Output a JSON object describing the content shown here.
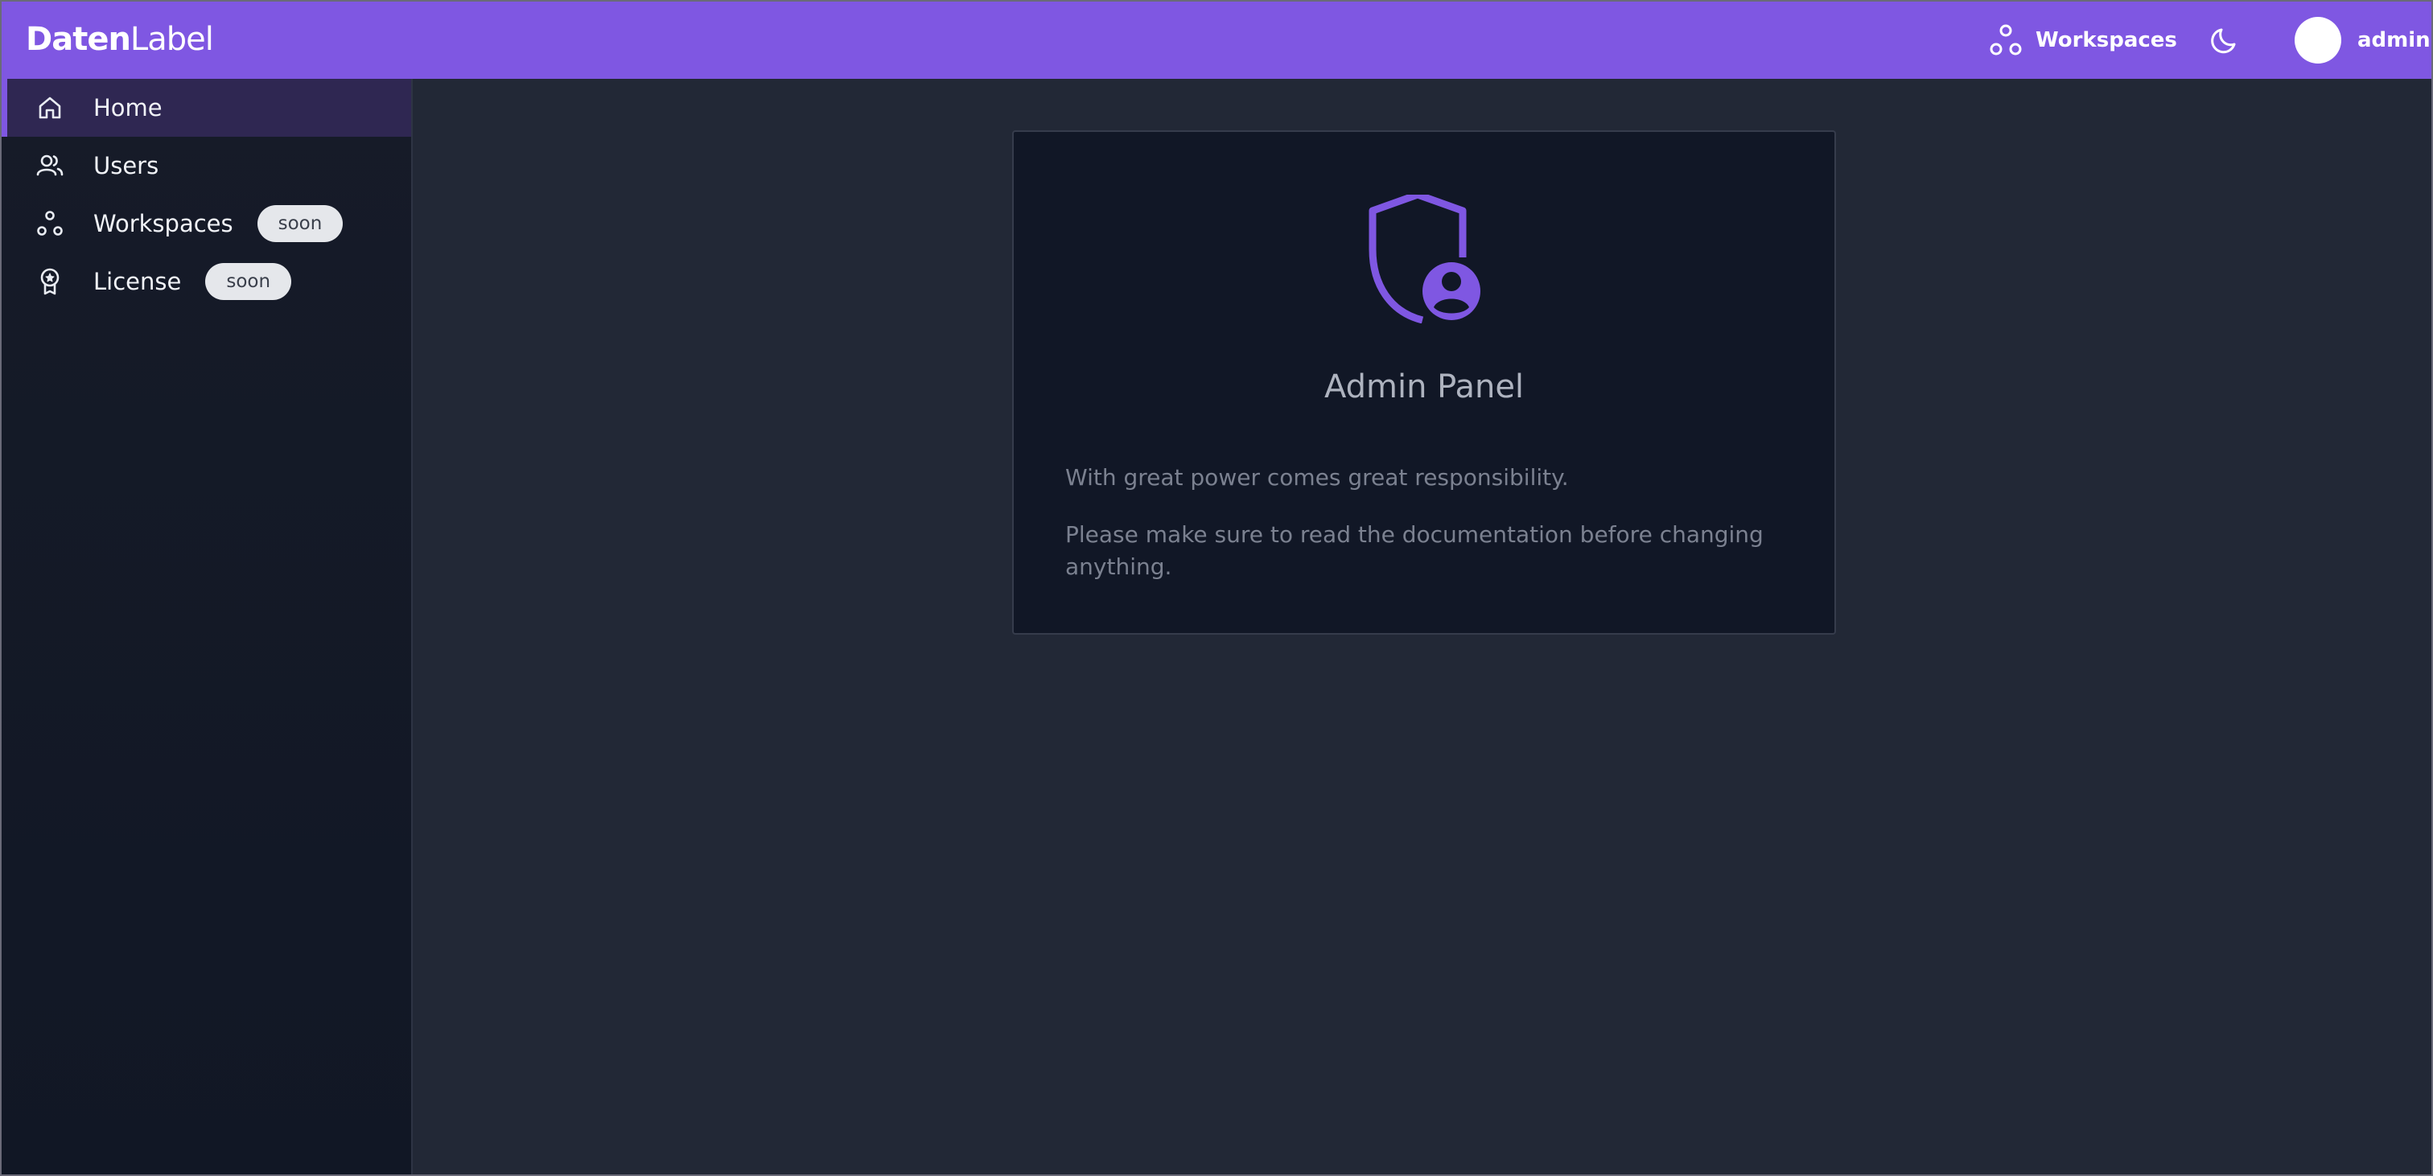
{
  "app": {
    "logo_bold": "Daten",
    "logo_light": "Label"
  },
  "header": {
    "workspaces_label": "Workspaces",
    "theme_icon": "moon-icon",
    "user_name": "admin"
  },
  "sidebar": {
    "items": [
      {
        "label": "Home",
        "icon": "home-icon",
        "active": true
      },
      {
        "label": "Users",
        "icon": "users-icon"
      },
      {
        "label": "Workspaces",
        "icon": "workspaces-icon",
        "badge": "soon"
      },
      {
        "label": "License",
        "icon": "license-icon",
        "badge": "soon"
      }
    ]
  },
  "main": {
    "card": {
      "icon": "shield-user-icon",
      "title": "Admin Panel",
      "line1": "With great power comes great responsibility.",
      "line2": "Please make sure to read the documentation before changing anything."
    }
  },
  "colors": {
    "accent": "#7f57e2",
    "background": "#222836",
    "sidebar": "#131927",
    "card": "#111726"
  }
}
